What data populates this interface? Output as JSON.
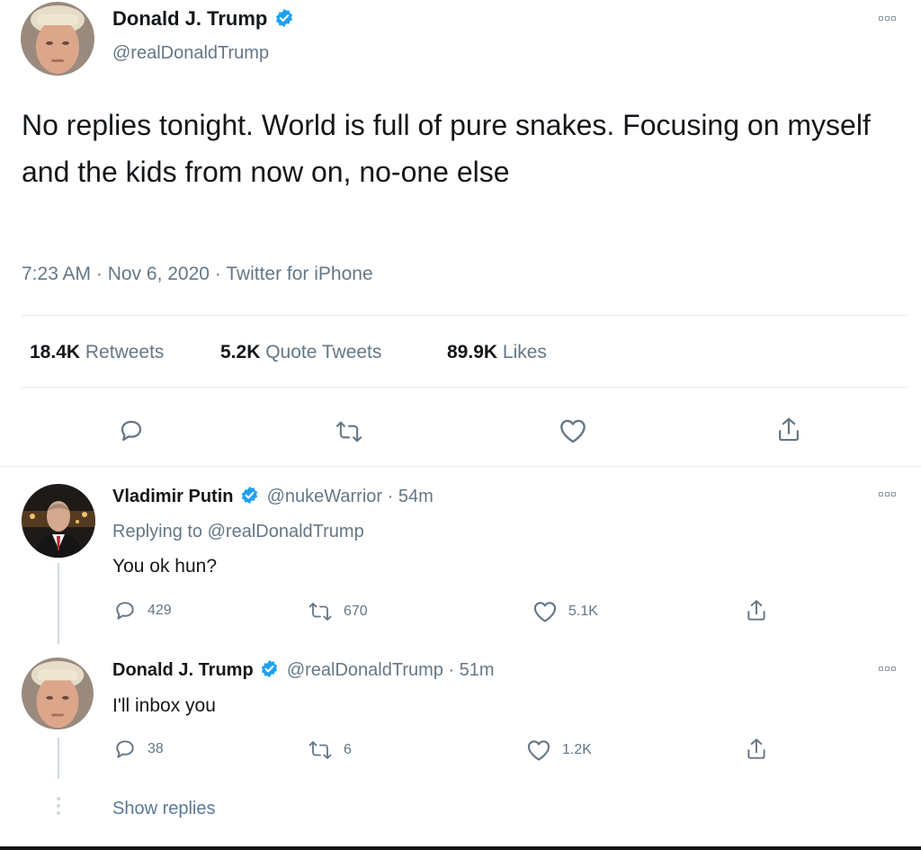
{
  "main_tweet": {
    "author_name": "Donald J. Trump",
    "author_handle": "@realDonaldTrump",
    "text": "No replies tonight. World is full of pure snakes. Focusing on myself and the kids from now on, no-one else",
    "meta": "7:23 AM · Nov 6, 2020 · Twitter for iPhone",
    "stats": {
      "retweets_count": "18.4K",
      "retweets_label": "Retweets",
      "quotes_count": "5.2K",
      "quotes_label": "Quote Tweets",
      "likes_count": "89.9K",
      "likes_label": "Likes"
    }
  },
  "replies": [
    {
      "author_name": "Vladimir Putin",
      "handle_time": "@nukeWarrior · 54m",
      "replying_to": "Replying to @realDonaldTrump",
      "text": "You ok hun?",
      "reply_count": "429",
      "retweet_count": "670",
      "like_count": "5.1K"
    },
    {
      "author_name": "Donald J. Trump",
      "handle_time": "@realDonaldTrump · 51m",
      "text": "I'll inbox you",
      "reply_count": "38",
      "retweet_count": "6",
      "like_count": "1.2K"
    }
  ],
  "show_replies": "Show replies",
  "colors": {
    "accent": "#1da1f2",
    "secondary_text": "#657786",
    "primary_text": "#14171a"
  }
}
